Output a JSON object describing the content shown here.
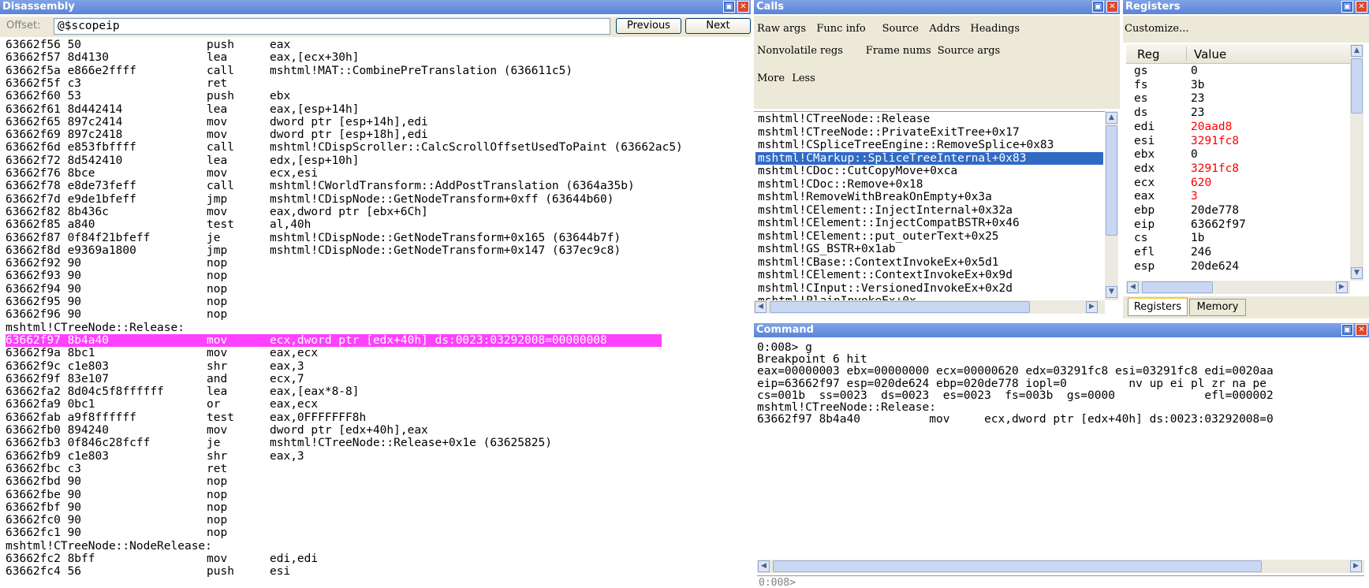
{
  "disassembly": {
    "title": "Disassembly",
    "offset_label": "Offset:",
    "offset_value": "@$scopeip",
    "prev_button": "Previous",
    "next_button": "Next",
    "lines": [
      {
        "addr": "63662f56 50",
        "mnemonic": "push",
        "operands": "eax"
      },
      {
        "addr": "63662f57 8d4130",
        "mnemonic": "lea",
        "operands": "eax,[ecx+30h]"
      },
      {
        "addr": "63662f5a e866e2ffff",
        "mnemonic": "call",
        "operands": "mshtml!MAT::CombinePreTranslation (636611c5)"
      },
      {
        "addr": "63662f5f c3",
        "mnemonic": "ret",
        "operands": ""
      },
      {
        "addr": "63662f60 53",
        "mnemonic": "push",
        "operands": "ebx"
      },
      {
        "addr": "63662f61 8d442414",
        "mnemonic": "lea",
        "operands": "eax,[esp+14h]"
      },
      {
        "addr": "63662f65 897c2414",
        "mnemonic": "mov",
        "operands": "dword ptr [esp+14h],edi"
      },
      {
        "addr": "63662f69 897c2418",
        "mnemonic": "mov",
        "operands": "dword ptr [esp+18h],edi"
      },
      {
        "addr": "63662f6d e853fbffff",
        "mnemonic": "call",
        "operands": "mshtml!CDispScroller::CalcScrollOffsetUsedToPaint (63662ac5)"
      },
      {
        "addr": "63662f72 8d542410",
        "mnemonic": "lea",
        "operands": "edx,[esp+10h]"
      },
      {
        "addr": "63662f76 8bce",
        "mnemonic": "mov",
        "operands": "ecx,esi"
      },
      {
        "addr": "63662f78 e8de73feff",
        "mnemonic": "call",
        "operands": "mshtml!CWorldTransform::AddPostTranslation (6364a35b)"
      },
      {
        "addr": "63662f7d e9de1bfeff",
        "mnemonic": "jmp",
        "operands": "mshtml!CDispNode::GetNodeTransform+0xff (63644b60)"
      },
      {
        "addr": "63662f82 8b436c",
        "mnemonic": "mov",
        "operands": "eax,dword ptr [ebx+6Ch]"
      },
      {
        "addr": "63662f85 a840",
        "mnemonic": "test",
        "operands": "al,40h"
      },
      {
        "addr": "63662f87 0f84f21bfeff",
        "mnemonic": "je",
        "operands": "mshtml!CDispNode::GetNodeTransform+0x165 (63644b7f)"
      },
      {
        "addr": "63662f8d e9369a1800",
        "mnemonic": "jmp",
        "operands": "mshtml!CDispNode::GetNodeTransform+0x147 (637ec9c8)"
      },
      {
        "addr": "63662f92 90",
        "mnemonic": "nop",
        "operands": ""
      },
      {
        "addr": "63662f93 90",
        "mnemonic": "nop",
        "operands": ""
      },
      {
        "addr": "63662f94 90",
        "mnemonic": "nop",
        "operands": ""
      },
      {
        "addr": "63662f95 90",
        "mnemonic": "nop",
        "operands": ""
      },
      {
        "addr": "63662f96 90",
        "mnemonic": "nop",
        "operands": ""
      },
      {
        "addr": "mshtml!CTreeNode::Release:",
        "mnemonic": "",
        "operands": ""
      },
      {
        "addr": "63662f97 8b4a40",
        "mnemonic": "mov",
        "operands": "ecx,dword ptr [edx+40h] ds:0023:03292008=00000008",
        "highlight": true
      },
      {
        "addr": "63662f9a 8bc1",
        "mnemonic": "mov",
        "operands": "eax,ecx"
      },
      {
        "addr": "63662f9c c1e803",
        "mnemonic": "shr",
        "operands": "eax,3"
      },
      {
        "addr": "63662f9f 83e107",
        "mnemonic": "and",
        "operands": "ecx,7"
      },
      {
        "addr": "63662fa2 8d04c5f8ffffff",
        "mnemonic": "lea",
        "operands": "eax,[eax*8-8]"
      },
      {
        "addr": "63662fa9 0bc1",
        "mnemonic": "or",
        "operands": "eax,ecx"
      },
      {
        "addr": "63662fab a9f8ffffff",
        "mnemonic": "test",
        "operands": "eax,0FFFFFFF8h"
      },
      {
        "addr": "63662fb0 894240",
        "mnemonic": "mov",
        "operands": "dword ptr [edx+40h],eax"
      },
      {
        "addr": "63662fb3 0f846c28fcff",
        "mnemonic": "je",
        "operands": "mshtml!CTreeNode::Release+0x1e (63625825)"
      },
      {
        "addr": "63662fb9 c1e803",
        "mnemonic": "shr",
        "operands": "eax,3"
      },
      {
        "addr": "63662fbc c3",
        "mnemonic": "ret",
        "operands": ""
      },
      {
        "addr": "63662fbd 90",
        "mnemonic": "nop",
        "operands": ""
      },
      {
        "addr": "63662fbe 90",
        "mnemonic": "nop",
        "operands": ""
      },
      {
        "addr": "63662fbf 90",
        "mnemonic": "nop",
        "operands": ""
      },
      {
        "addr": "63662fc0 90",
        "mnemonic": "nop",
        "operands": ""
      },
      {
        "addr": "63662fc1 90",
        "mnemonic": "nop",
        "operands": ""
      },
      {
        "addr": "mshtml!CTreeNode::NodeRelease:",
        "mnemonic": "",
        "operands": ""
      },
      {
        "addr": "63662fc2 8bff",
        "mnemonic": "mov",
        "operands": "edi,edi"
      },
      {
        "addr": "63662fc4 56",
        "mnemonic": "push",
        "operands": "esi"
      }
    ]
  },
  "calls": {
    "title": "Calls",
    "toolbar_row1": [
      "Raw args",
      "Func info",
      "Source",
      "Addrs",
      "Headings"
    ],
    "toolbar_row2": [
      "Nonvolatile regs",
      "Frame nums",
      "Source args"
    ],
    "toolbar_row3": [
      "More",
      "Less"
    ],
    "frames": [
      "mshtml!CTreeNode::Release",
      "mshtml!CTreeNode::PrivateExitTree+0x17",
      "mshtml!CSpliceTreeEngine::RemoveSplice+0x83",
      "mshtml!CMarkup::SpliceTreeInternal+0x83",
      "mshtml!CDoc::CutCopyMove+0xca",
      "mshtml!CDoc::Remove+0x18",
      "mshtml!RemoveWithBreakOnEmpty+0x3a",
      "mshtml!CElement::InjectInternal+0x32a",
      "mshtml!CElement::InjectCompatBSTR+0x46",
      "mshtml!CElement::put_outerText+0x25",
      "mshtml!GS_BSTR+0x1ab",
      "mshtml!CBase::ContextInvokeEx+0x5d1",
      "mshtml!CElement::ContextInvokeEx+0x9d",
      "mshtml!CInput::VersionedInvokeEx+0x2d",
      "mshtml!PlainInvokeEx+0x"
    ],
    "selected_index": 3
  },
  "registers": {
    "title": "Registers",
    "customize": "Customize...",
    "col_reg": "Reg",
    "col_value": "Value",
    "rows": [
      {
        "reg": "gs",
        "value": "0",
        "changed": false
      },
      {
        "reg": "fs",
        "value": "3b",
        "changed": false
      },
      {
        "reg": "es",
        "value": "23",
        "changed": false
      },
      {
        "reg": "ds",
        "value": "23",
        "changed": false
      },
      {
        "reg": "edi",
        "value": "20aad8",
        "changed": true
      },
      {
        "reg": "esi",
        "value": "3291fc8",
        "changed": true
      },
      {
        "reg": "ebx",
        "value": "0",
        "changed": false
      },
      {
        "reg": "edx",
        "value": "3291fc8",
        "changed": true
      },
      {
        "reg": "ecx",
        "value": "620",
        "changed": true
      },
      {
        "reg": "eax",
        "value": "3",
        "changed": true
      },
      {
        "reg": "ebp",
        "value": "20de778",
        "changed": false
      },
      {
        "reg": "eip",
        "value": "63662f97",
        "changed": false
      },
      {
        "reg": "cs",
        "value": "1b",
        "changed": false
      },
      {
        "reg": "efl",
        "value": "246",
        "changed": false
      },
      {
        "reg": "esp",
        "value": "20de624",
        "changed": false
      }
    ],
    "tabs": [
      "Registers",
      "Memory"
    ]
  },
  "command": {
    "title": "Command",
    "lines": [
      "0:008> g",
      "Breakpoint 6 hit",
      "eax=00000003 ebx=00000000 ecx=00000620 edx=03291fc8 esi=03291fc8 edi=0020aa",
      "eip=63662f97 esp=020de624 ebp=020de778 iopl=0         nv up ei pl zr na pe",
      "cs=001b  ss=0023  ds=0023  es=0023  fs=003b  gs=0000             efl=000002",
      "mshtml!CTreeNode::Release:",
      "63662f97 8b4a40          mov     ecx,dword ptr [edx+40h] ds:0023:03292008=0"
    ],
    "prompt": "0:008>"
  },
  "colors": {
    "titlebar": "#6a90dc",
    "highlight_row": "#ff40ff",
    "selected_frame": "#316ac5",
    "changed_register": "#ff0000"
  }
}
